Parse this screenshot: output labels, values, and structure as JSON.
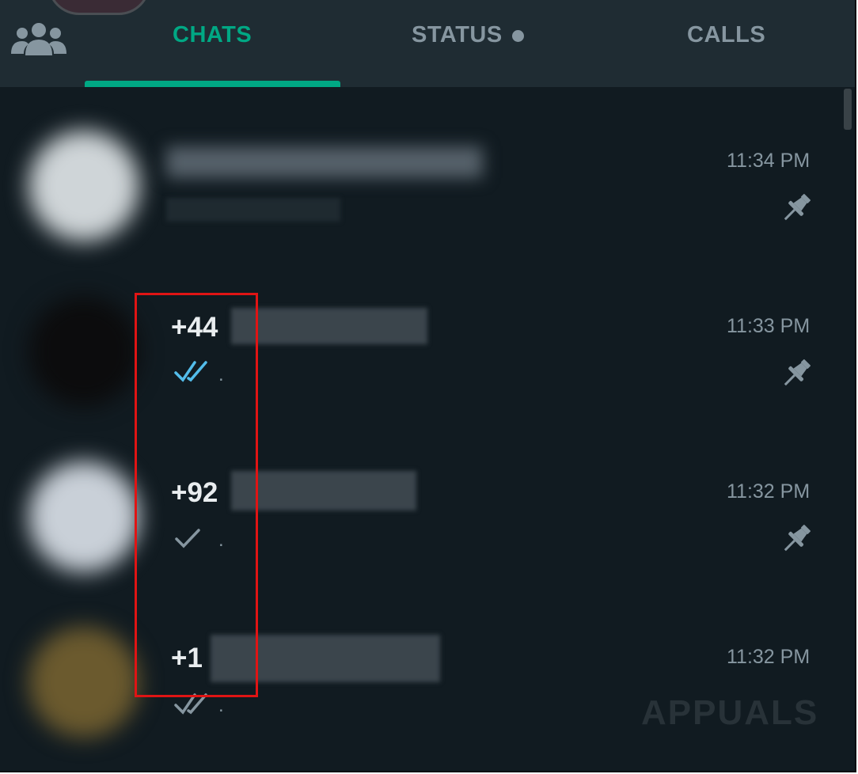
{
  "tabs": {
    "chats_label": "CHATS",
    "status_label": "STATUS",
    "calls_label": "CALLS"
  },
  "colors": {
    "accent": "#00a884",
    "background": "#111b21",
    "header": "#1f2c33",
    "read_tick": "#53bdeb",
    "highlight": "#e01414"
  },
  "chats": [
    {
      "name": "",
      "time": "11:34 PM",
      "pinned": true,
      "tick": "none",
      "preview": ""
    },
    {
      "name": "+44",
      "time": "11:33 PM",
      "pinned": true,
      "tick": "double-blue",
      "preview": "."
    },
    {
      "name": "+92",
      "time": "11:32 PM",
      "pinned": true,
      "tick": "single-grey",
      "preview": "."
    },
    {
      "name": "+1",
      "time": "11:32 PM",
      "pinned": false,
      "tick": "double-grey",
      "preview": "."
    }
  ],
  "icons": {
    "community": "community-icon",
    "pin": "pin-icon",
    "read_tick": "double-check-icon",
    "sent_tick": "single-check-icon"
  },
  "watermark": "APPUALS"
}
